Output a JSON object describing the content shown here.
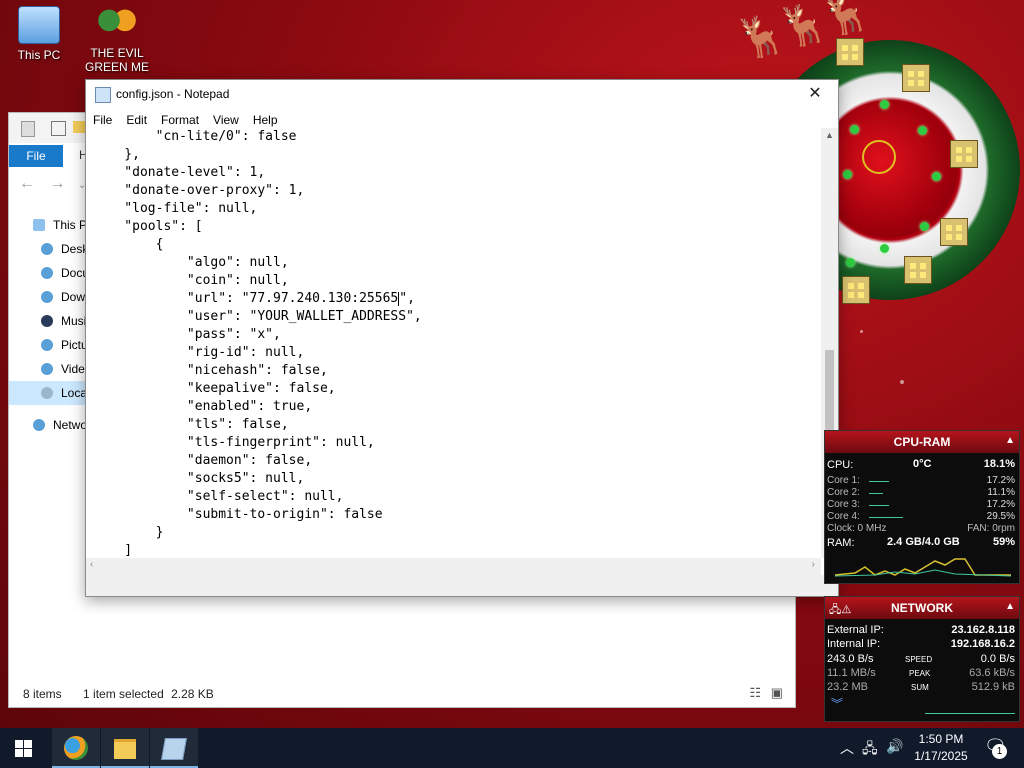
{
  "desktop": {
    "icons": [
      {
        "label": "This PC",
        "icon": "this-pc-icon"
      },
      {
        "label": "THE EVIL GREEN ME",
        "icon": "shortcut-people-icon"
      }
    ]
  },
  "explorer": {
    "file_tab": "File",
    "h_tab": "H",
    "sidebar": [
      {
        "label": "This PC",
        "icon": "this-pc-icon"
      },
      {
        "label": "Desktop",
        "icon": "desktop-icon"
      },
      {
        "label": "Documents",
        "icon": "documents-icon"
      },
      {
        "label": "Downloads",
        "icon": "downloads-icon"
      },
      {
        "label": "Music",
        "icon": "music-icon"
      },
      {
        "label": "Pictures",
        "icon": "pictures-icon"
      },
      {
        "label": "Videos",
        "icon": "videos-icon"
      },
      {
        "label": "Local Disk",
        "icon": "drive-icon",
        "selected": true
      },
      {
        "label": "Network",
        "icon": "network-icon"
      }
    ],
    "status": {
      "items": "8 items",
      "selected": "1 item selected",
      "size": "2.28 KB"
    }
  },
  "notepad": {
    "title": "config.json - Notepad",
    "menu": [
      "File",
      "Edit",
      "Format",
      "View",
      "Help"
    ],
    "close_glyph": "✕",
    "lines": [
      "        \"cn-lite/0\": false",
      "    },",
      "    \"donate-level\": 1,",
      "    \"donate-over-proxy\": 1,",
      "    \"log-file\": null,",
      "    \"pools\": [",
      "        {",
      "            \"algo\": null,",
      "            \"coin\": null,",
      "            \"url\": \"77.97.240.130:25565\",",
      "            \"user\": \"YOUR_WALLET_ADDRESS\",",
      "            \"pass\": \"x\",",
      "            \"rig-id\": null,",
      "            \"nicehash\": false,",
      "            \"keepalive\": false,",
      "            \"enabled\": true,",
      "            \"tls\": false,",
      "            \"tls-fingerprint\": null,",
      "            \"daemon\": false,",
      "            \"socks5\": null,",
      "            \"self-select\": null,",
      "            \"submit-to-origin\": false",
      "        }",
      "    ]"
    ]
  },
  "cpu_gadget": {
    "title": "CPU-RAM",
    "cpu_label": "CPU:",
    "temp": "0°C",
    "cpu_pct": "18.1%",
    "cores": [
      {
        "label": "Core 1:",
        "value": "17.2%"
      },
      {
        "label": "Core 2:",
        "value": "11.1%"
      },
      {
        "label": "Core 3:",
        "value": "17.2%"
      },
      {
        "label": "Core 4:",
        "value": "29.5%"
      }
    ],
    "clock": "Clock: 0 MHz",
    "fan": "FAN: 0rpm",
    "ram_label": "RAM:",
    "ram": "2.4 GB/4.0 GB",
    "ram_pct": "59%"
  },
  "network_gadget": {
    "title": "NETWORK",
    "external_label": "External IP:",
    "external_ip": "23.162.8.118",
    "internal_label": "Internal IP:",
    "internal_ip": "192.168.16.2",
    "rows": [
      {
        "left": "243.0 B/s",
        "mid": "SPEED",
        "right": "0.0 B/s"
      },
      {
        "left": "11.1 MB/s",
        "mid": "PEAK",
        "right": "63.6 kB/s"
      },
      {
        "left": "23.2 MB",
        "mid": "SUM",
        "right": "512.9 kB"
      }
    ]
  },
  "taskbar": {
    "time": "1:50 PM",
    "date": "1/17/2025",
    "notifications": "1"
  },
  "colors": {
    "accent": "#1979ca",
    "gadget_header": "#b5141c",
    "taskbar": "#101a2a"
  }
}
